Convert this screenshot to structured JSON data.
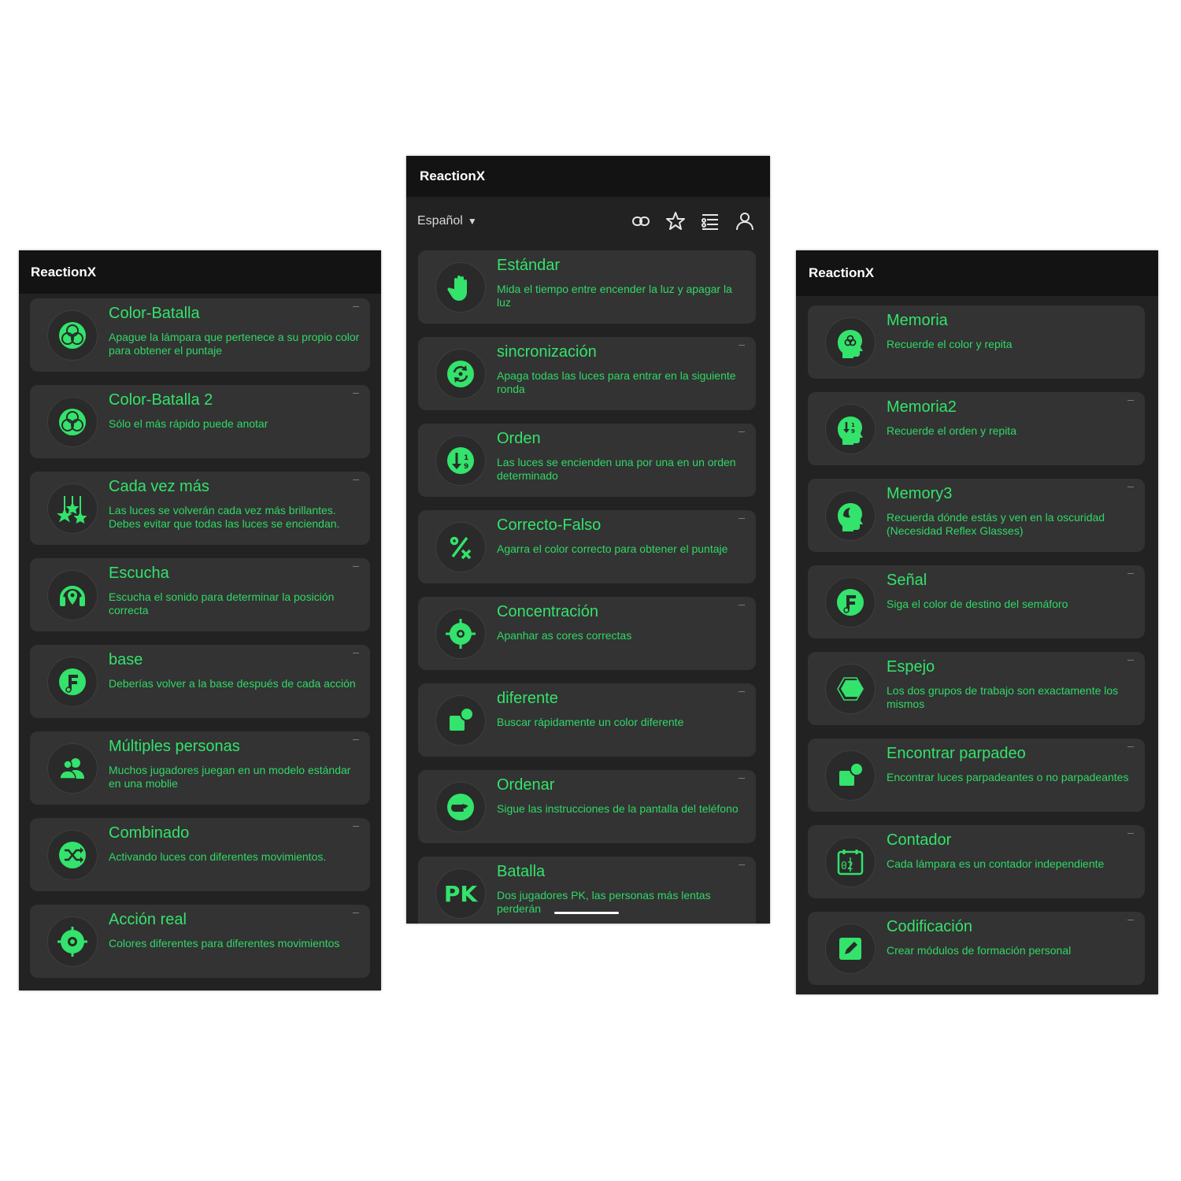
{
  "colors": {
    "accent": "#33e36b",
    "card": "#333333",
    "screen": "#222222",
    "titlebar": "#131313"
  },
  "left": {
    "app_title": "ReactionX",
    "items": [
      {
        "title": "Color-Batalla",
        "desc": "Apague la lámpara que pertenece a su propio color para obtener el puntaje",
        "icon": "venn-circles-icon"
      },
      {
        "title": "Color-Batalla 2",
        "desc": "Sólo el más rápido puede anotar",
        "icon": "venn-circles-icon"
      },
      {
        "title": "Cada vez más",
        "desc": "Las luces se volverán cada vez más brillantes. Debes evitar que todas las luces se enciendan.",
        "icon": "hanging-stars-icon"
      },
      {
        "title": "Escucha",
        "desc": "Escucha el sonido para determinar la posición correcta",
        "icon": "headphones-pin-icon"
      },
      {
        "title": "base",
        "desc": "Deberías volver a la base después de cada acción",
        "icon": "base-f-icon"
      },
      {
        "title": "Múltiples personas",
        "desc": "Muchos jugadores juegan en un modelo estándar en una moblie",
        "icon": "people-icon"
      },
      {
        "title": "Combinado",
        "desc": "Activando luces con diferentes movimientos.",
        "icon": "shuffle-icon"
      },
      {
        "title": "Acción real",
        "desc": "Colores diferentes para diferentes movimientos",
        "icon": "crosshair-icon"
      }
    ]
  },
  "center": {
    "app_title": "ReactionX",
    "language": "Español",
    "toolbar_icons": [
      "link-icon",
      "star-icon",
      "list-settings-icon",
      "user-icon"
    ],
    "items": [
      {
        "title": "Estándar",
        "desc": "Mida el tiempo entre encender la luz y apagar la luz",
        "icon": "hand-icon"
      },
      {
        "title": "sincronización",
        "desc": "Apaga todas las luces para entrar en la siguiente ronda",
        "icon": "sync-icon"
      },
      {
        "title": "Orden",
        "desc": "Las luces se encienden una por una en un orden determinado",
        "icon": "sort-order-icon"
      },
      {
        "title": "Correcto-Falso",
        "desc": "Agarra el color correcto para obtener el puntaje",
        "icon": "percent-x-icon"
      },
      {
        "title": "Concentración",
        "desc": "Apanhar as cores correctas",
        "icon": "target-icon"
      },
      {
        "title": "diferente",
        "desc": "Buscar rápidamente un color diferente",
        "icon": "shapes-icon"
      },
      {
        "title": "Ordenar",
        "desc": "Sigue las instrucciones de la pantalla del teléfono",
        "icon": "pointing-hand-icon"
      },
      {
        "title": "Batalla",
        "desc": "Dos jugadores PK, las personas más lentas perderán",
        "icon": "pk-icon",
        "icon_text": "PK"
      }
    ]
  },
  "right": {
    "app_title": "ReactionX",
    "items": [
      {
        "title": "Memoria",
        "desc": "Recuerde el color y repita",
        "icon": "head-brain-icon"
      },
      {
        "title": "Memoria2",
        "desc": "Recuerde el orden y repita",
        "icon": "head-order-icon"
      },
      {
        "title": "Memory3",
        "desc": "Recuerda dónde estás y ven en la oscuridad (Necesidad Reflex Glasses)",
        "icon": "head-dark-icon"
      },
      {
        "title": "Señal",
        "desc": "Siga el color de destino del semáforo",
        "icon": "signal-f-icon"
      },
      {
        "title": "Espejo",
        "desc": "Los dos grupos de trabajo son exactamente los mismos",
        "icon": "hexagon-icon"
      },
      {
        "title": "Encontrar parpadeo",
        "desc": "Encontrar luces parpadeantes o no parpadeantes",
        "icon": "shapes-icon"
      },
      {
        "title": "Contador",
        "desc": "Cada lámpara es un contador independiente",
        "icon": "counter-icon",
        "icon_text": "02"
      },
      {
        "title": "Codificación",
        "desc": "Crear módulos de formación personal",
        "icon": "edit-icon"
      }
    ]
  }
}
